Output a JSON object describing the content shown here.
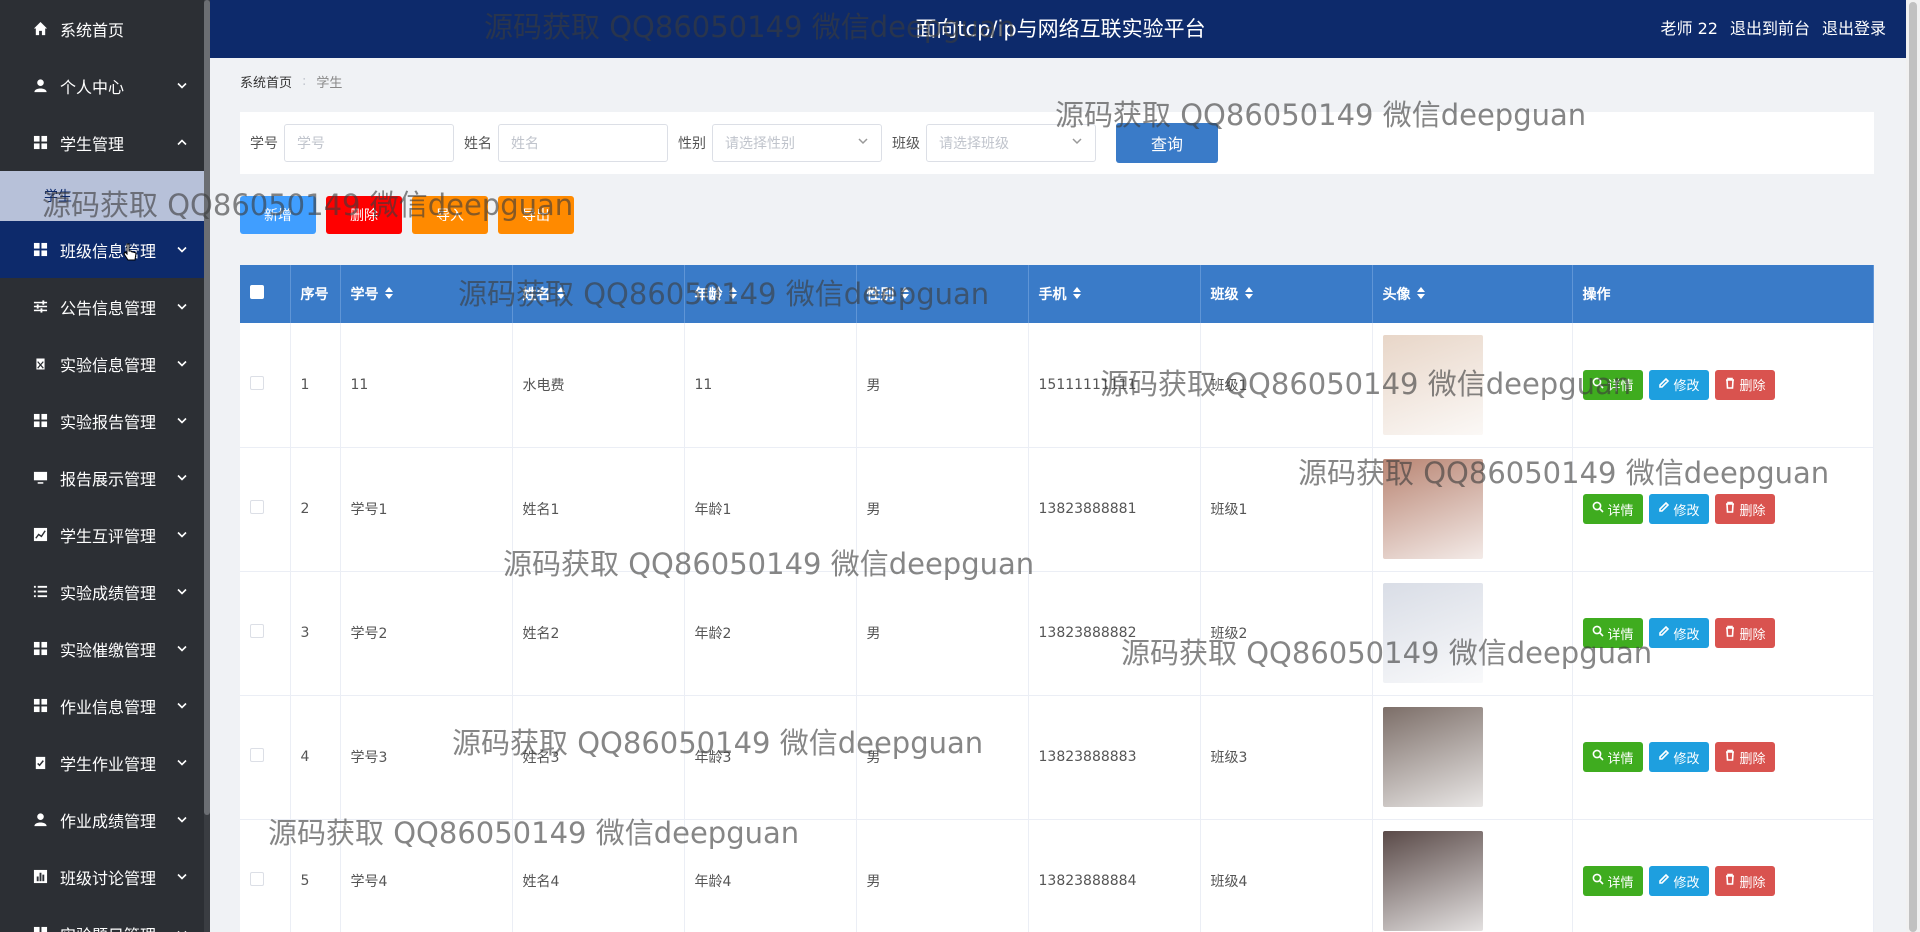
{
  "header": {
    "title": "面向tcp/ip与网络互联实验平台",
    "user": "老师 22",
    "to_front": "退出到前台",
    "logout": "退出登录",
    "bg_color": "#0d2a6b"
  },
  "sidebar": {
    "items": [
      {
        "label": "系统首页",
        "icon": "home-icon",
        "chevron": ""
      },
      {
        "label": "个人中心",
        "icon": "user-icon",
        "chevron": "down"
      },
      {
        "label": "学生管理",
        "icon": "grid-icon",
        "chevron": "up"
      },
      {
        "label": "班级信息管理",
        "icon": "grid-icon",
        "chevron": "down"
      },
      {
        "label": "公告信息管理",
        "icon": "sliders-icon",
        "chevron": "down"
      },
      {
        "label": "实验信息管理",
        "icon": "clipboard-icon",
        "chevron": "down"
      },
      {
        "label": "实验报告管理",
        "icon": "grid-icon",
        "chevron": "down"
      },
      {
        "label": "报告展示管理",
        "icon": "monitor-icon",
        "chevron": "down"
      },
      {
        "label": "学生互评管理",
        "icon": "chart-icon",
        "chevron": "down"
      },
      {
        "label": "实验成绩管理",
        "icon": "list-icon",
        "chevron": "down"
      },
      {
        "label": "实验催缴管理",
        "icon": "grid-icon",
        "chevron": "down"
      },
      {
        "label": "作业信息管理",
        "icon": "grid-icon",
        "chevron": "down"
      },
      {
        "label": "学生作业管理",
        "icon": "clipboard-check-icon",
        "chevron": "down"
      },
      {
        "label": "作业成绩管理",
        "icon": "user-icon",
        "chevron": "down"
      },
      {
        "label": "班级讨论管理",
        "icon": "bar-chart-icon",
        "chevron": "down"
      },
      {
        "label": "实验题目管理",
        "icon": "grid-icon",
        "chevron": "down"
      }
    ],
    "submenu": {
      "label": "学生"
    }
  },
  "breadcrumb": {
    "home": "系统首页",
    "sep": ":",
    "current": "学生"
  },
  "search": {
    "xuehao": {
      "label": "学号",
      "placeholder": "学号"
    },
    "xingming": {
      "label": "姓名",
      "placeholder": "姓名"
    },
    "xingbie": {
      "label": "性别",
      "placeholder": "请选择性别"
    },
    "banji": {
      "label": "班级",
      "placeholder": "请选择班级"
    },
    "query": "查询"
  },
  "actions": {
    "add": "新增",
    "delete": "删除",
    "import": "导入",
    "export": "导出"
  },
  "table": {
    "columns": [
      "序号",
      "学号",
      "姓名",
      "年龄",
      "性别",
      "手机",
      "班级",
      "头像",
      "操作"
    ],
    "rows": [
      {
        "index": "1",
        "xuehao": "11",
        "name": "水电费",
        "age": "11",
        "gender": "男",
        "phone": "15111111111",
        "class": "班级1",
        "avatar_color": "#e8d6c8"
      },
      {
        "index": "2",
        "xuehao": "学号1",
        "name": "姓名1",
        "age": "年龄1",
        "gender": "男",
        "phone": "13823888881",
        "class": "班级1",
        "avatar_color": "#b98573"
      },
      {
        "index": "3",
        "xuehao": "学号2",
        "name": "姓名2",
        "age": "年龄2",
        "gender": "男",
        "phone": "13823888882",
        "class": "班级2",
        "avatar_color": "#d9dde6"
      },
      {
        "index": "4",
        "xuehao": "学号3",
        "name": "姓名3",
        "age": "年龄3",
        "gender": "男",
        "phone": "13823888883",
        "class": "班级3",
        "avatar_color": "#7c6e68"
      },
      {
        "index": "5",
        "xuehao": "学号4",
        "name": "姓名4",
        "age": "年龄4",
        "gender": "男",
        "phone": "13823888884",
        "class": "班级4",
        "avatar_color": "#5a4a48"
      }
    ],
    "ops": {
      "detail": "详情",
      "edit": "修改",
      "del": "删除"
    }
  },
  "colors": {
    "primary": "#3a7bc8",
    "add": "#409eff",
    "delete": "#ff0000",
    "import": "#ff8a00",
    "export": "#ff8a00",
    "detail": "#3fac1f",
    "edit": "#1e9fdf",
    "del": "#d9534f"
  },
  "watermark": "源码获取 QQ86050149 微信deepguan"
}
